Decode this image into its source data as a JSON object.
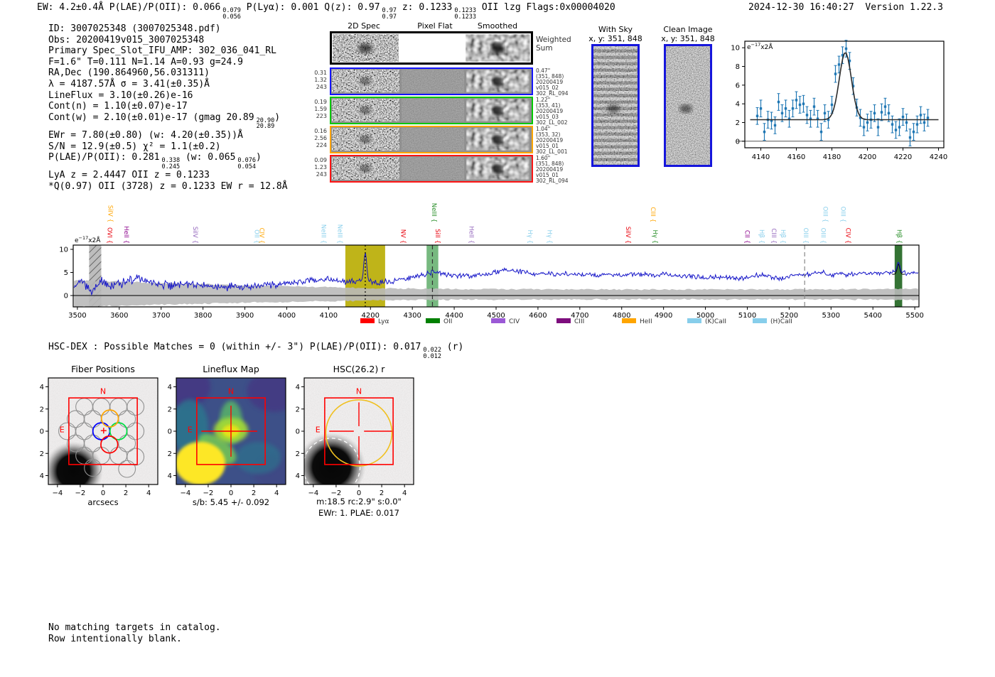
{
  "header": {
    "segments": [
      [
        "t",
        "EW: 4.2±0.4Å  P(LAE)/P(OII): 0.066"
      ],
      [
        "frac",
        "0.079",
        "0.056"
      ],
      [
        "t",
        "  P(Lyα): 0.001  Q(z): 0.97"
      ],
      [
        "frac",
        "0.97",
        "0.97"
      ],
      [
        "t",
        "  z: 0.1233"
      ],
      [
        "frac",
        "0.1233",
        "0.1233"
      ],
      [
        "t",
        " OII   lzg  Flags:0x00004020"
      ]
    ],
    "timestamp": "2024-12-30 16:40:27",
    "version": "Version 1.22.3"
  },
  "info_lines": [
    [
      [
        "t",
        "ID: 3007025348 (3007025348.pdf)"
      ]
    ],
    [
      [
        "t",
        "Obs: 20200419v015_3007025348"
      ]
    ],
    [
      [
        "t",
        "Primary Spec_Slot_IFU_AMP: 302_036_041_RL"
      ]
    ],
    [
      [
        "t",
        "F=1.6\"  T=0.111  N=1.14  A=0.93  g=24.9"
      ]
    ],
    [
      [
        "t",
        "RA,Dec (190.864960,56.031311)"
      ]
    ],
    [
      [
        "t",
        "λ = 4187.57Å  σ = 3.41(±0.35)Å"
      ]
    ],
    [
      [
        "t",
        "LineFlux = 3.10(±0.26)e-16"
      ]
    ],
    [
      [
        "t",
        "Cont(n) = 1.10(±0.07)e-17"
      ]
    ],
    [
      [
        "t",
        "Cont(w) = 2.10(±0.01)e-17 (gmag 20.89"
      ],
      [
        "frac",
        "20.90",
        "20.89"
      ],
      [
        "t",
        ")"
      ]
    ],
    [
      [
        "t",
        "EWr = 7.80(±0.80) (w: 4.20(±0.35))Å"
      ]
    ],
    [
      [
        "t",
        "S/N = 12.9(±0.5)  χ² = 1.1(±0.2)"
      ]
    ],
    [
      [
        "t",
        "P(LAE)/P(OII): 0.281"
      ],
      [
        "frac",
        "0.338",
        "0.245"
      ],
      [
        "t",
        " (w: 0.065"
      ],
      [
        "frac",
        "0.076",
        "0.054"
      ],
      [
        "t",
        ")"
      ]
    ],
    [
      [
        "t",
        "LyA z = 2.4447  OII z = 0.1233"
      ]
    ],
    [
      [
        "t",
        "*Q(0.97) OII (3728) z = 0.1233  EW r = 12.8Å"
      ]
    ]
  ],
  "cutouts": {
    "col_headers": [
      "2D Spec",
      "Pixel Flat",
      "Smoothed"
    ],
    "weighted_label_lines": [
      "Weighted",
      "Sum"
    ],
    "rows": [
      {
        "border": "#1414ff",
        "left": [
          "0.31",
          "1.32",
          "243"
        ],
        "right": [
          "0.47\"",
          "(351, 848)",
          "20200419",
          "v015_02",
          "302_RL_094"
        ]
      },
      {
        "border": "#00c800",
        "left": [
          "0.19",
          "1.59",
          "223"
        ],
        "right": [
          "1.22\"",
          "(353, 41)",
          "20200419",
          "v015_03",
          "302_LL_002"
        ]
      },
      {
        "border": "#ffa500",
        "left": [
          "0.16",
          "2.56",
          "224"
        ],
        "right": [
          "1.04\"",
          "(353, 32)",
          "20200419",
          "v015_01",
          "302_LL_001"
        ]
      },
      {
        "border": "#ff1414",
        "left": [
          "0.09",
          "1.23",
          "243"
        ],
        "right": [
          "1.60\"",
          "(351, 848)",
          "20200419",
          "v015_01",
          "302_RL_094"
        ]
      }
    ]
  },
  "sky_panels": [
    {
      "title": "With Sky",
      "subtitle": "x, y: 351, 848",
      "kind": "sky"
    },
    {
      "title": "Clean Image",
      "subtitle": "x, y: 351, 848",
      "kind": "clean"
    }
  ],
  "hsc_dex": [
    [
      "t",
      "HSC-DEX : Possible Matches = 0 (within +/- 3\")  P(LAE)/P(OII): 0.017"
    ],
    [
      "frac",
      "0.022",
      "0.012"
    ],
    [
      "t",
      " (r)"
    ]
  ],
  "footer_lines": [
    "No matching targets in catalog.",
    "Row intentionally blank."
  ],
  "chart_data": [
    {
      "id": "zoom_spectrum",
      "type": "line",
      "ylabel_inplot": {
        "prefix": "e",
        "sup": "−17",
        "suffix": "x2Å"
      },
      "xlim": [
        4131,
        4243
      ],
      "ylim": [
        -0.7,
        10.7
      ],
      "xticks": [
        4140,
        4160,
        4180,
        4200,
        4220,
        4240
      ],
      "yticks": [
        0,
        2,
        4,
        6,
        8,
        10
      ],
      "points_x": [
        4138,
        4140,
        4142,
        4144,
        4146,
        4148,
        4150,
        4152,
        4154,
        4156,
        4158,
        4160,
        4162,
        4164,
        4166,
        4168,
        4170,
        4172,
        4174,
        4176,
        4178,
        4180,
        4182,
        4184,
        4186,
        4188,
        4190,
        4192,
        4194,
        4196,
        4198,
        4200,
        4202,
        4204,
        4206,
        4208,
        4210,
        4212,
        4214,
        4216,
        4218,
        4220,
        4222,
        4224,
        4226,
        4228,
        4230,
        4232,
        4234
      ],
      "points_y": [
        2.7,
        3.5,
        1.0,
        2.3,
        2.2,
        1.7,
        4.2,
        3.0,
        3.5,
        2.4,
        3.5,
        4.4,
        3.9,
        4.0,
        2.8,
        2.4,
        3.7,
        2.4,
        1.0,
        3.0,
        2.3,
        3.9,
        7.2,
        8.2,
        9.2,
        9.9,
        8.6,
        5.9,
        3.6,
        2.5,
        1.5,
        2.0,
        2.3,
        3.0,
        1.5,
        3.1,
        3.7,
        3.0,
        1.8,
        1.2,
        1.5,
        2.6,
        2.0,
        0.4,
        1.0,
        1.8,
        2.8,
        2.0,
        2.5
      ],
      "point_err": 0.9,
      "fit": {
        "center": 4187.57,
        "sigma": 3.41,
        "peak": 9.5,
        "continuum": 2.3
      },
      "point_color": "#1f77b4",
      "fit_color": "#2b2b2b"
    },
    {
      "id": "main_spectrum",
      "type": "line",
      "ylabel_inplot": {
        "prefix": "e",
        "sup": "−17",
        "suffix": "x2Å"
      },
      "xlim": [
        3490,
        5510
      ],
      "xticks": [
        3500,
        3600,
        3700,
        3800,
        3900,
        4000,
        4100,
        4200,
        4300,
        4400,
        4500,
        4600,
        4700,
        4800,
        4900,
        5000,
        5100,
        5200,
        5300,
        5400,
        5500
      ],
      "yticks": [
        0,
        5,
        10
      ],
      "line_color": "#1515c8",
      "noise_seed": 987654,
      "anchors_x": [
        3495,
        3505,
        3515,
        3525,
        3535,
        3545,
        3555,
        3565,
        3575,
        3585,
        3595,
        3605,
        3615,
        3625,
        3635,
        3645,
        3655,
        3665,
        3675,
        3685,
        3695,
        3710,
        3730,
        3750,
        3770,
        3790,
        3810,
        3830,
        3850,
        3870,
        3890,
        3910,
        3930,
        3950,
        3970,
        3990,
        4010,
        4030,
        4050,
        4070,
        4090,
        4110,
        4130,
        4150,
        4170,
        4200,
        4220,
        4240,
        4260,
        4280,
        4300,
        4320,
        4340,
        4360,
        4380,
        4400,
        4420,
        4440,
        4460,
        4480,
        4500,
        4520,
        4540,
        4560,
        4580,
        4600,
        4620,
        4640,
        4660,
        4680,
        4700,
        4720,
        4740,
        4760,
        4780,
        4800,
        4820,
        4840,
        4860,
        4880,
        4900,
        4920,
        4940,
        4960,
        4980,
        5000,
        5020,
        5040,
        5060,
        5080,
        5100,
        5120,
        5140,
        5160,
        5180,
        5200,
        5220,
        5240,
        5260,
        5280,
        5300,
        5320,
        5340,
        5360,
        5380,
        5400,
        5420,
        5440,
        5460,
        5480,
        5505
      ],
      "anchors_y": [
        2.0,
        3.6,
        2.6,
        1.4,
        1.0,
        1.8,
        2.8,
        2.6,
        2.1,
        2.4,
        2.7,
        2.5,
        3.1,
        3.8,
        3.2,
        4.2,
        2.9,
        2.6,
        3.2,
        2.7,
        2.2,
        2.4,
        2.2,
        2.4,
        2.5,
        2.2,
        2.0,
        1.8,
        1.7,
        1.9,
        1.7,
        1.9,
        2.1,
        2.2,
        2.2,
        2.4,
        2.7,
        2.9,
        3.1,
        3.4,
        3.5,
        3.3,
        3.1,
        3.1,
        3.2,
        3.0,
        2.8,
        3.0,
        3.2,
        3.5,
        3.9,
        4.3,
        4.9,
        5.1,
        4.4,
        4.3,
        4.4,
        4.2,
        4.5,
        4.8,
        5.1,
        5.4,
        5.5,
        5.2,
        4.8,
        4.6,
        4.8,
        4.6,
        4.8,
        4.5,
        4.4,
        4.6,
        4.4,
        4.7,
        4.5,
        4.4,
        4.6,
        4.5,
        4.7,
        4.4,
        4.6,
        4.3,
        4.1,
        4.3,
        4.0,
        3.9,
        4.1,
        3.8,
        4.0,
        3.7,
        3.9,
        4.3,
        4.5,
        3.9,
        3.6,
        4.3,
        4.6,
        4.4,
        4.9,
        5.1,
        4.5,
        4.8,
        4.4,
        4.7,
        4.9,
        4.5,
        4.8,
        5.0,
        5.2,
        4.7,
        4.9
      ],
      "peaks": [
        {
          "c": 4187.57,
          "s": 3.4,
          "h": 6.2
        },
        {
          "c": 5461,
          "s": 3.2,
          "h": 2.2
        }
      ],
      "noise_x": [
        3500,
        3700,
        3900,
        4100,
        4300,
        4500,
        5000,
        5500
      ],
      "noise_amp": [
        1.5,
        1.2,
        1.0,
        0.8,
        0.7,
        0.6,
        0.6,
        0.65
      ],
      "envelope_x": [
        3500,
        3600,
        3700,
        3800,
        3900,
        4000,
        4100,
        4200,
        4300,
        4400,
        4600,
        4800,
        5000,
        5200,
        5400,
        5500
      ],
      "envelope_upper": [
        3.3,
        3.0,
        2.7,
        2.5,
        2.2,
        2.0,
        1.8,
        1.6,
        1.5,
        1.4,
        1.35,
        1.3,
        1.3,
        1.3,
        1.4,
        1.5
      ],
      "envelope_color": "#b9b9b9",
      "bands": [
        {
          "x0": 3528,
          "x1": 3557,
          "type": "hatched",
          "color": "#aaaaaa"
        },
        {
          "x0": 4140,
          "x1": 4235,
          "type": "solid",
          "color": "#b8ac00",
          "opacity": 0.9,
          "vline": 4187.57,
          "vline_style": "dotted",
          "vline_color": "#000000"
        },
        {
          "x0": 4334,
          "x1": 4362,
          "type": "solid",
          "color": "#55a860",
          "opacity": 0.8,
          "vline": 4348,
          "vline_style": "dashed",
          "vline_color": "#333333"
        },
        {
          "x0": 5452,
          "x1": 5470,
          "type": "solid",
          "color": "#1e641e",
          "opacity": 0.9
        }
      ],
      "extra_vlines": [
        {
          "x": 5237,
          "style": "dashed",
          "color": "#888888"
        }
      ],
      "line_labels": [
        {
          "wave": 3572,
          "text": "OVI {",
          "color": "#e8000b",
          "tier": 0
        },
        {
          "wave": 3574,
          "text": "SiIV {",
          "color": "#ffa500",
          "tier": 1
        },
        {
          "wave": 3612,
          "text": "HeII {",
          "color": "#8b008b",
          "tier": 0
        },
        {
          "wave": 3777,
          "text": "SiIV {",
          "color": "#9467bd",
          "tier": 0
        },
        {
          "wave": 3924,
          "text": "OII {",
          "color": "#87ceeb",
          "tier": 0
        },
        {
          "wave": 3936,
          "text": "CIV {",
          "color": "#ffa500",
          "tier": 0
        },
        {
          "wave": 4083,
          "text": "NeIII {",
          "color": "#87ceeb",
          "tier": 0
        },
        {
          "wave": 4122,
          "text": "NeIII {",
          "color": "#87ceeb",
          "tier": 0
        },
        {
          "wave": 4273,
          "text": "NV {",
          "color": "#e8000b",
          "tier": 0
        },
        {
          "wave": 4347,
          "text": "NeIII {",
          "color": "#228b22",
          "tier": 1
        },
        {
          "wave": 4356,
          "text": "SiII {",
          "color": "#e8000b",
          "tier": 0
        },
        {
          "wave": 4436,
          "text": "HeII {",
          "color": "#9467bd",
          "tier": 0
        },
        {
          "wave": 4576,
          "text": "Hγ {",
          "color": "#87ceeb",
          "tier": 0
        },
        {
          "wave": 4623,
          "text": "Hγ {",
          "color": "#87ceeb",
          "tier": 0
        },
        {
          "wave": 4811,
          "text": "SiIV {",
          "color": "#e8000b",
          "tier": 0
        },
        {
          "wave": 4870,
          "text": "CIII {",
          "color": "#ffa500",
          "tier": 1
        },
        {
          "wave": 4875,
          "text": "Hγ {",
          "color": "#228b22",
          "tier": 0
        },
        {
          "wave": 5095,
          "text": "CII {",
          "color": "#8b008b",
          "tier": 0
        },
        {
          "wave": 5130,
          "text": "Hβ {",
          "color": "#87ceeb",
          "tier": 0
        },
        {
          "wave": 5159,
          "text": "CIII {",
          "color": "#9467bd",
          "tier": 0
        },
        {
          "wave": 5181,
          "text": "Hβ {",
          "color": "#87ceeb",
          "tier": 0
        },
        {
          "wave": 5235,
          "text": "OIII {",
          "color": "#87ceeb",
          "tier": 0
        },
        {
          "wave": 5277,
          "text": "OIII {",
          "color": "#87ceeb",
          "tier": 0
        },
        {
          "wave": 5282,
          "text": "OIII {",
          "color": "#87ceeb",
          "tier": 1
        },
        {
          "wave": 5324,
          "text": "OIII {",
          "color": "#87ceeb",
          "tier": 1
        },
        {
          "wave": 5336,
          "text": "CIV {",
          "color": "#e8000b",
          "tier": 0
        },
        {
          "wave": 5458,
          "text": "Hβ {",
          "color": "#228b22",
          "tier": 0
        }
      ],
      "legend": [
        {
          "label": "Lyα",
          "color": "#ff0000"
        },
        {
          "label": "OII",
          "color": "#008000"
        },
        {
          "label": "CIV",
          "color": "#9b59d6"
        },
        {
          "label": "CIII",
          "color": "#7d0d7d"
        },
        {
          "label": "HeII",
          "color": "#ffa500"
        },
        {
          "label": "(K)CaII",
          "color": "#87ceeb"
        },
        {
          "label": "(H)CaII",
          "color": "#87ceeb"
        }
      ]
    },
    {
      "id": "fiber_positions",
      "type": "scatter",
      "title": "Fiber Positions",
      "xlabel": "arcsecs",
      "ticks": [
        -4,
        -2,
        0,
        2,
        4
      ],
      "lim": [
        -4.8,
        4.8
      ],
      "box": [
        -3,
        3
      ],
      "compass_n": "N",
      "compass_e": "E",
      "fiber_radius": 0.74,
      "gray_fibers": [
        [
          -1.65,
          2.2
        ],
        [
          -0.15,
          2.2
        ],
        [
          1.35,
          2.2
        ],
        [
          2.85,
          2.2
        ],
        [
          -2.4,
          1.1
        ],
        [
          -0.9,
          1.1
        ],
        [
          2.1,
          1.1
        ],
        [
          -3.15,
          0
        ],
        [
          -1.65,
          0
        ],
        [
          2.85,
          0
        ],
        [
          -2.4,
          -1.1
        ],
        [
          -0.9,
          -1.1
        ],
        [
          2.1,
          -1.1
        ],
        [
          -1.65,
          -2.2
        ],
        [
          -0.15,
          -2.2
        ],
        [
          1.35,
          -2.2
        ],
        [
          2.85,
          -2.3
        ],
        [
          -0.9,
          -3.3
        ],
        [
          2.1,
          -3.4
        ]
      ],
      "colored_fibers": [
        {
          "x": -0.15,
          "y": 0,
          "color": "#0000ff"
        },
        {
          "x": 1.35,
          "y": 0,
          "color": "#00dd44"
        },
        {
          "x": 0.6,
          "y": 1.15,
          "color": "#ffa500"
        },
        {
          "x": 0.55,
          "y": -1.2,
          "color": "#ff0000"
        }
      ],
      "center_marker": {
        "x": 0.05,
        "y": 0.05,
        "symbol": "+",
        "color": "#ff0000"
      },
      "blob": {
        "x": -2.6,
        "y": -3.6,
        "r": 2.6
      }
    },
    {
      "id": "lineflux_map",
      "type": "heatmap",
      "title": "Lineflux Map",
      "xlabel": "s/b: 5.45 +/- 0.092",
      "ticks": [
        -4,
        -2,
        0,
        2,
        4
      ],
      "lim": [
        -4.8,
        4.8
      ],
      "box": [
        -3,
        3
      ],
      "compass_n": "N",
      "compass_e": "E",
      "crosshair": {
        "x": 0,
        "y": 0,
        "len": 2.3,
        "color": "#ff0000"
      },
      "colormap": {
        "low": "#3d5088",
        "mid": "#2a788e",
        "high": "#5ec962",
        "peak": "#fde725"
      }
    },
    {
      "id": "hsc_cutout",
      "type": "image",
      "title": "HSC(26.2) r",
      "xlabel1": "m:18.5 rc:2.9\" s:0.0\"",
      "xlabel2": "EWr: 1. PLAE: 0.017",
      "ticks": [
        -4,
        -2,
        0,
        2,
        4
      ],
      "lim": [
        -4.8,
        4.8
      ],
      "box": [
        -3,
        3
      ],
      "compass_n": "N",
      "compass_e": "E",
      "aperture": {
        "x": 0,
        "y": -0.15,
        "r": 2.9,
        "color": "#f0c020"
      },
      "blob": {
        "x": -2.4,
        "y": -3.2,
        "r": 3.0
      },
      "dashed_circle": {
        "x": -2.4,
        "y": -3.2,
        "r": 2.5,
        "color": "#ffffff"
      },
      "crosshair": {
        "gap": 0.45,
        "len": 2.6,
        "color": "#ff0000"
      }
    }
  ]
}
